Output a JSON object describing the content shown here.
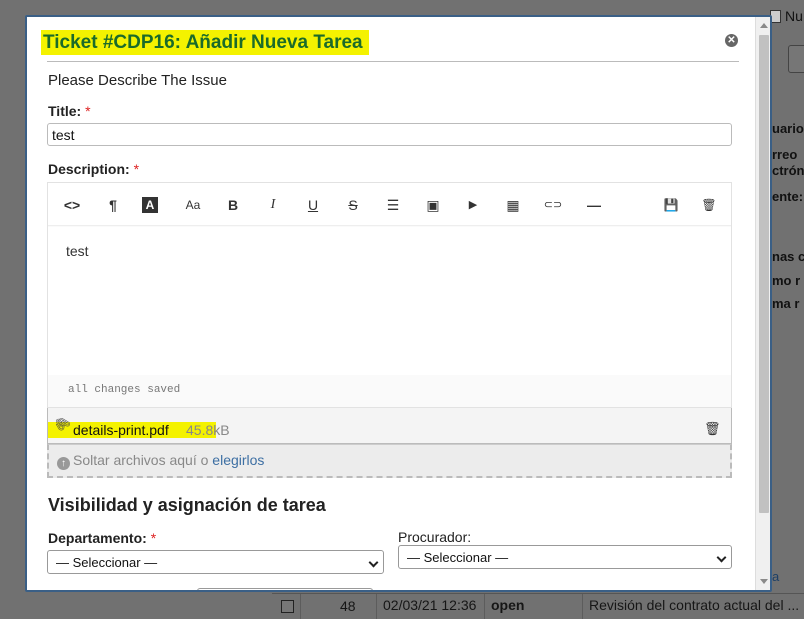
{
  "background": {
    "tab_label": "Nu",
    "side_fragments": [
      "uario",
      "rreo",
      "ctrón",
      "ente:",
      "nas c",
      "mo r",
      "ma r",
      "a"
    ],
    "row": {
      "number": "48",
      "date": "02/03/21 12:36",
      "status": "open",
      "subject": "Revisión del contrato actual del ..."
    }
  },
  "modal": {
    "title": "Ticket #CDP16: Añadir Nueva Tarea",
    "subtitle": "Please Describe The Issue",
    "title_field": {
      "label": "Title:",
      "required_mark": "*",
      "value": "test"
    },
    "description": {
      "label": "Description:",
      "required_mark": "*",
      "body": "test",
      "status": "all changes saved",
      "toolbar": [
        {
          "name": "code-view-icon",
          "glyph": "<>"
        },
        {
          "name": "paragraph-icon",
          "glyph": "¶"
        },
        {
          "name": "text-color-icon",
          "glyph": "A"
        },
        {
          "name": "font-size-icon",
          "glyph": "Aa"
        },
        {
          "name": "bold-icon",
          "glyph": "B"
        },
        {
          "name": "italic-icon",
          "glyph": "I"
        },
        {
          "name": "underline-icon",
          "glyph": "U"
        },
        {
          "name": "strikethrough-icon",
          "glyph": "S"
        },
        {
          "name": "list-icon",
          "glyph": "☰"
        },
        {
          "name": "image-icon",
          "glyph": "▣"
        },
        {
          "name": "video-icon",
          "glyph": "▶"
        },
        {
          "name": "table-icon",
          "glyph": "▦"
        },
        {
          "name": "link-icon",
          "glyph": "⊂⊃"
        },
        {
          "name": "horizontal-rule-icon",
          "glyph": "—"
        },
        {
          "name": "save-draft-icon",
          "glyph": "💾"
        },
        {
          "name": "delete-draft-icon",
          "glyph": "🗑"
        }
      ]
    },
    "attachment": {
      "filename": "details-print.pdf",
      "size": "45.8kB"
    },
    "dropzone": {
      "text": "Soltar archivos aquí o",
      "link": "elegirlos"
    },
    "visibility": {
      "heading": "Visibilidad y asignación de tarea",
      "department": {
        "label": "Departamento:",
        "required_mark": "*",
        "selected": "— Seleccionar —"
      },
      "procurador": {
        "label": "Procurador:",
        "selected": "— Seleccionar —"
      }
    },
    "highlight_color": "#f4f200",
    "title_color": "#1b6b2a"
  }
}
